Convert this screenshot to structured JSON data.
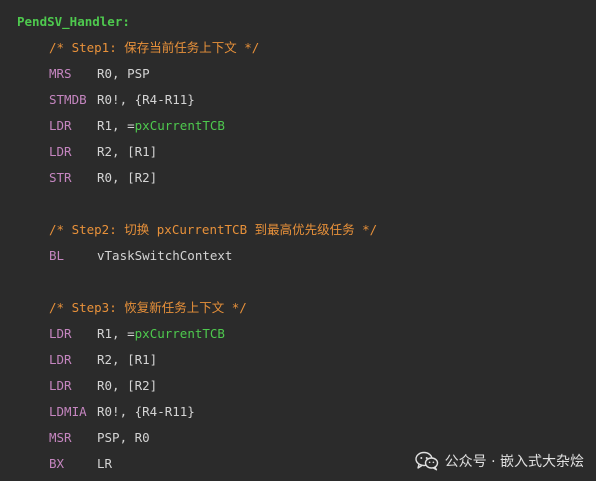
{
  "code": {
    "label": "PendSV_Handler:",
    "step1_comment": "/* Step1: 保存当前任务上下文 */",
    "l_mrs_op": "MRS",
    "l_mrs_args": "R0, PSP",
    "l_stmdb_op": "STMDB",
    "l_stmdb_args": "R0!, {R4-R11}",
    "l_ldr1_op": "LDR",
    "l_ldr1_args_pre": "R1, =",
    "l_ldr1_sym": "pxCurrentTCB",
    "l_ldr2_op": "LDR",
    "l_ldr2_args": "R2, [R1]",
    "l_str_op": "STR",
    "l_str_args": "R0, [R2]",
    "step2_comment": "/* Step2: 切换 pxCurrentTCB 到最高优先级任务 */",
    "l_bl_op": "BL",
    "l_bl_args": "vTaskSwitchContext",
    "step3_comment": "/* Step3: 恢复新任务上下文 */",
    "l_ldr3_op": "LDR",
    "l_ldr3_args_pre": "R1, =",
    "l_ldr3_sym": "pxCurrentTCB",
    "l_ldr4_op": "LDR",
    "l_ldr4_args": "R2, [R1]",
    "l_ldr5_op": "LDR",
    "l_ldr5_args": "R0, [R2]",
    "l_ldmia_op": "LDMIA",
    "l_ldmia_args": "R0!, {R4-R11}",
    "l_msr_op": "MSR",
    "l_msr_args": "PSP, R0",
    "l_bx_op": "BX",
    "l_bx_args": "LR"
  },
  "watermark": {
    "text": "公众号 · 嵌入式大杂烩",
    "icon": "wechat-icon"
  },
  "colors": {
    "background": "#2b2b2b",
    "label": "#4ec94e",
    "comment": "#e8913a",
    "opcode": "#c586c0",
    "text": "#d4d4d4"
  }
}
